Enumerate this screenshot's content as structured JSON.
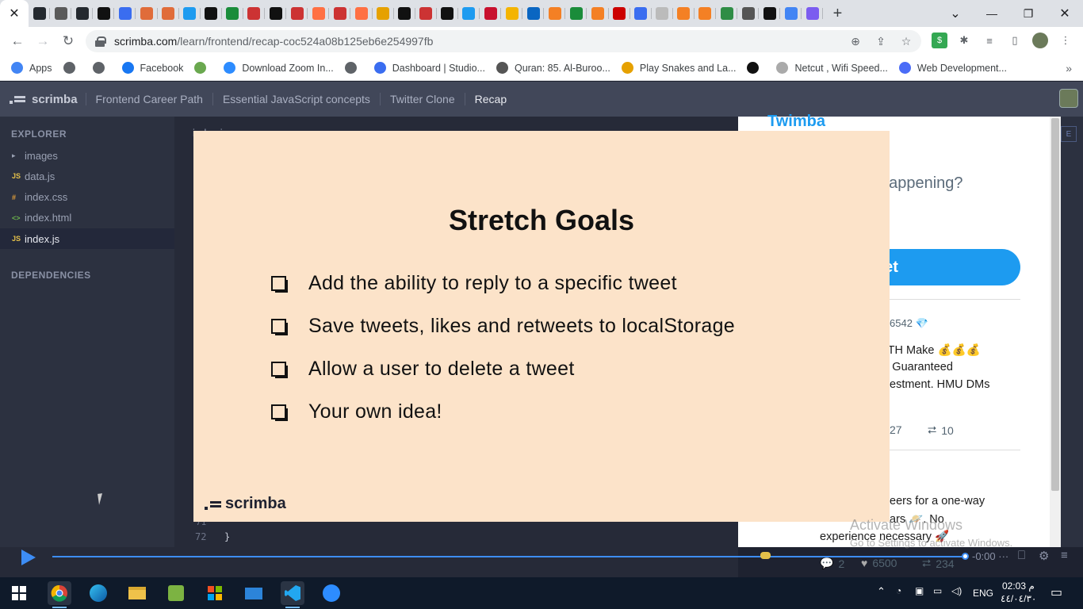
{
  "browser": {
    "address": {
      "host": "scrimba.com",
      "path": "/learn/frontend/recap-coc524a08b125eb6e254997fb"
    },
    "window_controls": {
      "minimize": "—",
      "maximize": "❐",
      "close": "✕"
    },
    "tab_close": "✕",
    "new_tab": "+",
    "tab_search": "⌄",
    "tab_favicon_colors": [
      "#24292f",
      "#5a5a5a",
      "#24292f",
      "#111",
      "#3a6df0",
      "#e06c3a",
      "#e06c3a",
      "#1d9bf0",
      "#111",
      "#1a8c3a",
      "#c33",
      "#111",
      "#c33",
      "#ff7043",
      "#c33",
      "#ff7043",
      "#e6a100",
      "#111",
      "#c33",
      "#111",
      "#1d9bf0",
      "#c8102e",
      "#f4b400",
      "#0a66c2",
      "#f48024",
      "#1a8c3a",
      "#f48024",
      "#c00",
      "#3a6df0",
      "#bbb",
      "#f48024",
      "#f48024",
      "#2f8d46",
      "#555",
      "#111",
      "#4285f4",
      "#7b5cf0"
    ],
    "bookmarks": [
      {
        "label": "Apps",
        "color": "#4285f4"
      },
      {
        "label": "",
        "color": "#5f6368"
      },
      {
        "label": "",
        "color": "#5f6368"
      },
      {
        "label": "Facebook",
        "color": "#1877f2"
      },
      {
        "label": "",
        "color": "#6aa84f"
      },
      {
        "label": "Download Zoom In...",
        "color": "#2d8cff"
      },
      {
        "label": "",
        "color": "#5f6368"
      },
      {
        "label": "Dashboard | Studio...",
        "color": "#3a6df0"
      },
      {
        "label": "Quran: 85. Al-Buroo...",
        "color": "#555"
      },
      {
        "label": "Play Snakes and La...",
        "color": "#e6a100"
      },
      {
        "label": "",
        "color": "#111"
      },
      {
        "label": "Netcut , Wifi Speed...",
        "color": "#aaa"
      },
      {
        "label": "Web Development...",
        "color": "#4a6cf7"
      }
    ],
    "bookmarks_overflow": "»"
  },
  "scrimba": {
    "logo": "scrimba",
    "breadcrumbs": [
      "Frontend Career Path",
      "Essential JavaScript concepts",
      "Twitter Clone",
      "Recap"
    ]
  },
  "sidebar": {
    "explorer_label": "EXPLORER",
    "files": [
      {
        "icon": "▸",
        "name": "images",
        "color": "#9aa1b3"
      },
      {
        "icon": "JS",
        "name": "data.js",
        "color": "#e4c04a"
      },
      {
        "icon": "#",
        "name": "index.css",
        "color": "#e4a03a"
      },
      {
        "icon": "<>",
        "name": "index.html",
        "color": "#6ab04c"
      },
      {
        "icon": "JS",
        "name": "index.js",
        "color": "#e4c04a"
      }
    ],
    "dependencies_label": "DEPENDENCIES"
  },
  "editor": {
    "tab_label": "index.js",
    "line_number": "72",
    "line_code": "}",
    "prev_line_number": "71"
  },
  "overlay": {
    "title": "Stretch Goals",
    "goals": [
      "Add the ability to reply to a specific tweet",
      "Save tweets, likes and retweets to localStorage",
      "Allow a user to delete a tweet",
      "Your own idea!"
    ],
    "logo": "scrimba"
  },
  "preview": {
    "title": "Twimba",
    "placeholder_fragment": "nappening?",
    "tweet_button_fragment": "eet",
    "tweet1": {
      "handle_fragment": "6542 💎",
      "line1": "ETH Make 💰💰💰",
      "line2": "s. Guaranteed",
      "line3": "estment. HMU DMs",
      "replies_fragment": "27",
      "retweets": "10"
    },
    "tweet2": {
      "line1": "eers for a one-way",
      "line2": "ars 🪐. No",
      "line3": "experience necessary 🚀",
      "replies": "2",
      "likes": "6500",
      "retweets": "234"
    },
    "tab_fragment": "E"
  },
  "player": {
    "time": "-0:00",
    "menu": "···",
    "watermark_title": "Activate Windows",
    "watermark_sub": "Go to Settings to activate Windows."
  },
  "taskbar": {
    "language": "ENG",
    "time": "02:03 م",
    "date": "٤٤/٠٤/٣٠"
  },
  "colors": {
    "overlay_bg": "#fce3c9",
    "accent_blue": "#1d9bf0",
    "player_blue": "#3d8df5",
    "scrimba_header": "#414759"
  }
}
